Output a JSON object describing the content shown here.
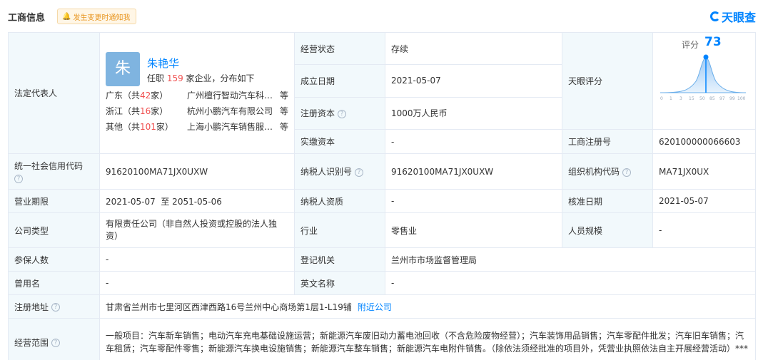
{
  "header": {
    "title": "工商信息",
    "notify_label": "发生变更时通知我",
    "brand": "天眼查"
  },
  "legal_rep": {
    "label": "法定代表人",
    "avatar_char": "朱",
    "name": "朱艳华",
    "summary_prefix": "任职 ",
    "summary_count": "159",
    "summary_suffix": " 家企业，分布如下",
    "rows": [
      {
        "prov": "广东（共",
        "count": "42",
        "unit": "家）",
        "company": "广州檀行智动汽车科…",
        "deng": "等"
      },
      {
        "prov": "浙江（共",
        "count": "16",
        "unit": "家）",
        "company": "杭州小鹏汽车有限公司",
        "deng": "等"
      },
      {
        "prov": "其他（共",
        "count": "101",
        "unit": "家）",
        "company": "上海小鹏汽车销售服…",
        "deng": "等"
      }
    ]
  },
  "rows": {
    "status": {
      "label": "经营状态",
      "value": "存续"
    },
    "established": {
      "label": "成立日期",
      "value": "2021-05-07"
    },
    "reg_capital": {
      "label": "注册资本",
      "value": "1000万人民币"
    },
    "paid_capital": {
      "label": "实缴资本",
      "value": "-"
    },
    "tyc_score": {
      "label": "天眼评分",
      "score_label": "评分",
      "score": "73",
      "axis": [
        "0",
        "1",
        "3",
        "15",
        "50",
        "85",
        "97",
        "99",
        "100"
      ]
    },
    "reg_no": {
      "label": "工商注册号",
      "value": "620100000066603"
    },
    "credit_code": {
      "label": "统一社会信用代码",
      "value": "91620100MA71JX0UXW"
    },
    "taxpayer_id": {
      "label": "纳税人识别号",
      "value": "91620100MA71JX0UXW"
    },
    "org_code": {
      "label": "组织机构代码",
      "value": "MA71JX0UX"
    },
    "term": {
      "label": "营业期限",
      "value": "2021-05-07  至 2051-05-06"
    },
    "taxpayer_qual": {
      "label": "纳税人资质",
      "value": "-"
    },
    "approval_date": {
      "label": "核准日期",
      "value": "2021-05-07"
    },
    "company_type": {
      "label": "公司类型",
      "value": "有限责任公司（非自然人投资或控股的法人独资）"
    },
    "industry": {
      "label": "行业",
      "value": "零售业"
    },
    "staff_size": {
      "label": "人员规模",
      "value": "-"
    },
    "insured": {
      "label": "参保人数",
      "value": "-"
    },
    "reg_authority": {
      "label": "登记机关",
      "value": "兰州市市场监督管理局"
    },
    "former_name": {
      "label": "曾用名",
      "value": "-"
    },
    "english_name": {
      "label": "英文名称",
      "value": "-"
    },
    "address": {
      "label": "注册地址",
      "value": "甘肃省兰州市七里河区西津西路16号兰州中心商场第1层1-L19铺",
      "link": "附近公司"
    },
    "scope": {
      "label": "经营范围",
      "value": "一般项目：汽车新车销售；电动汽车充电基础设施运营；新能源汽车废旧动力蓄电池回收（不含危险废物经营）；汽车装饰用品销售；汽车零配件批发；汽车旧车销售；汽车租赁；汽车零配件零售；新能源汽车换电设施销售；新能源汽车整车销售；新能源汽车电附件销售。（除依法须经批准的项目外，凭营业执照依法自主开展经营活动）***"
    }
  },
  "colors": {
    "accent": "#0084ff",
    "label_bg": "#f2f9fc",
    "border": "#e4eaf3",
    "highlight": "#f04f4f"
  }
}
